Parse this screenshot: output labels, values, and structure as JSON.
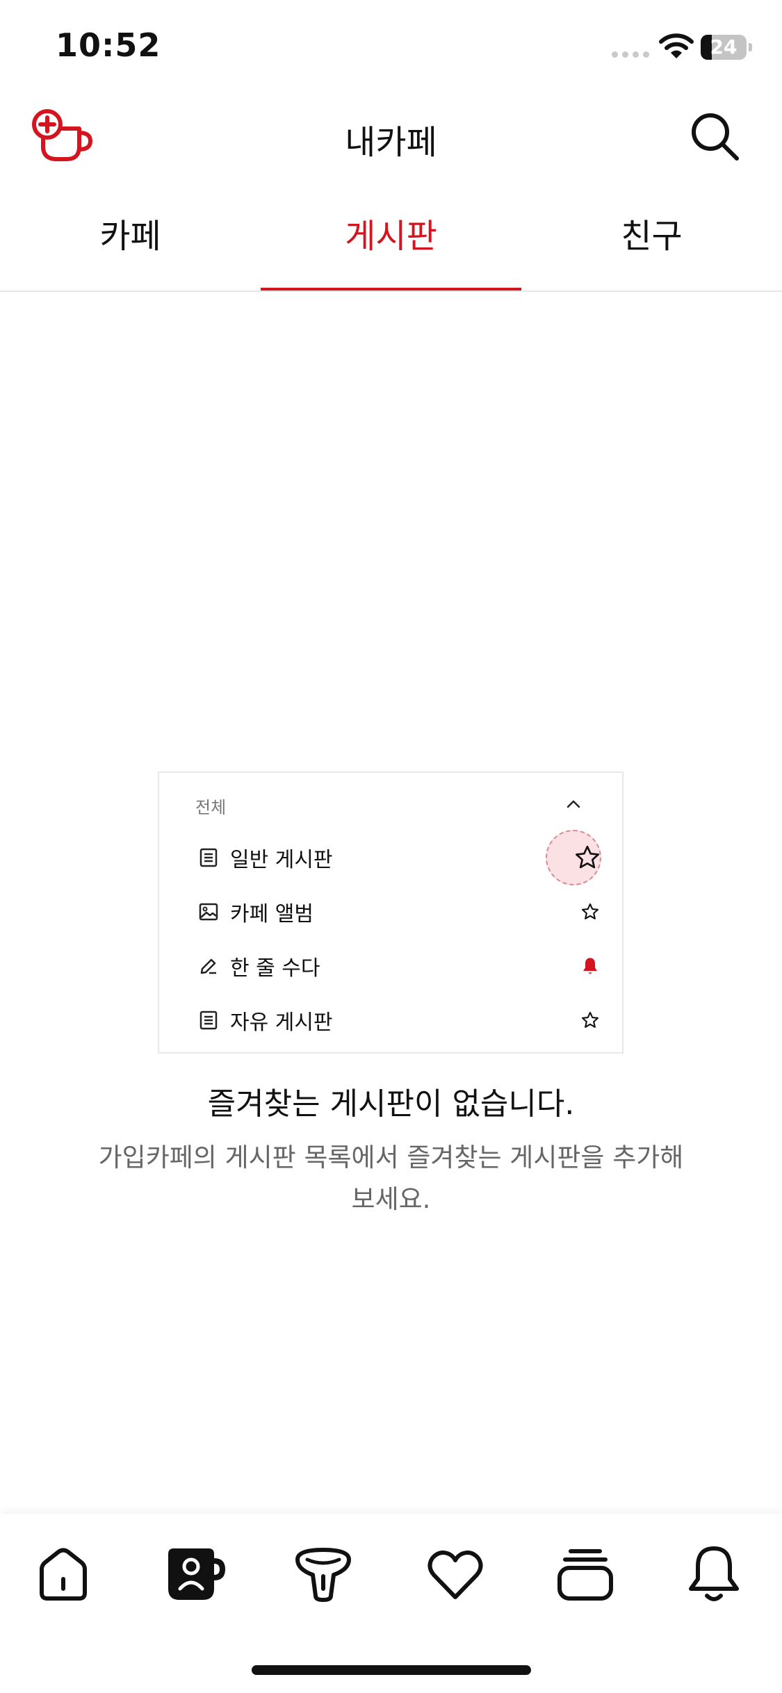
{
  "status_bar": {
    "time": "10:52",
    "battery": "24",
    "battery_level": 0.24
  },
  "header": {
    "title": "내카페"
  },
  "tabs": [
    {
      "label": "카페",
      "active": false
    },
    {
      "label": "게시판",
      "active": true
    },
    {
      "label": "친구",
      "active": false
    }
  ],
  "illustration": {
    "header_label": "전체",
    "rows": [
      {
        "label": "일반 게시판",
        "icon": "list-icon",
        "right": "star-outline-icon",
        "highlighted": true
      },
      {
        "label": "카페 앨범",
        "icon": "image-icon",
        "right": "star-outline-icon",
        "highlighted": false
      },
      {
        "label": "한 줄 수다",
        "icon": "pencil-icon",
        "right": "bell-filled-icon",
        "highlighted": false
      },
      {
        "label": "자유 게시판",
        "icon": "list-icon",
        "right": "star-outline-icon",
        "highlighted": false
      }
    ]
  },
  "empty_state": {
    "title": "즐겨찾는 게시판이 없습니다.",
    "description": "가입카페의 게시판 목록에서 즐겨찾는 게시판을 추가해보세요."
  },
  "bottom_nav": [
    {
      "name": "home-icon",
      "active": false
    },
    {
      "name": "my-cafe-icon",
      "active": true
    },
    {
      "name": "explore-icon",
      "active": false
    },
    {
      "name": "heart-icon",
      "active": false
    },
    {
      "name": "feed-stack-icon",
      "active": false
    },
    {
      "name": "bell-icon",
      "active": false
    }
  ],
  "colors": {
    "accent": "#d4141e",
    "text": "#111111",
    "muted": "#666666",
    "divider": "#e6e6e6"
  }
}
